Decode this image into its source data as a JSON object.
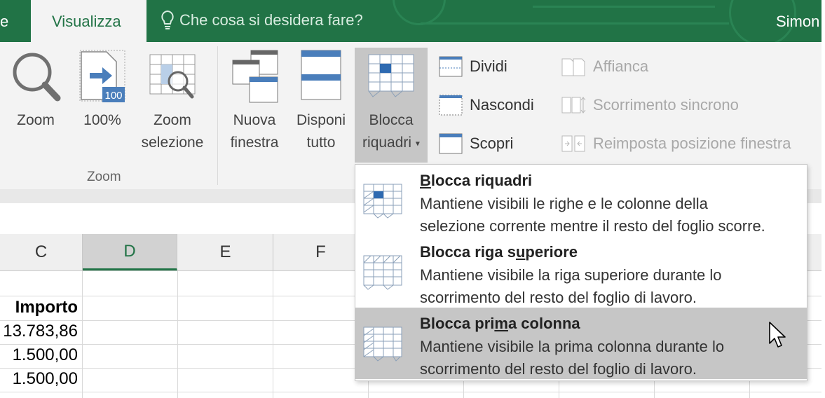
{
  "tabs": {
    "left_partial": "e",
    "active": "Visualizza",
    "tell_me": "Che cosa si desidera fare?",
    "user": "Simon"
  },
  "ribbon": {
    "zoom": "Zoom",
    "hundred": "100%",
    "hundred_badge": "100",
    "zoom_sel_1": "Zoom",
    "zoom_sel_2": "selezione",
    "group_zoom": "Zoom",
    "new_win_1": "Nuova",
    "new_win_2": "finestra",
    "arrange_1": "Disponi",
    "arrange_2": "tutto",
    "freeze_1": "Blocca",
    "freeze_2": "riquadri",
    "split": "Dividi",
    "hide": "Nascondi",
    "unhide": "Scopri",
    "side_by_side": "Affianca",
    "sync_scroll": "Scorrimento sincrono",
    "reset_pos": "Reimposta posizione finestra"
  },
  "grid": {
    "columns": [
      "C",
      "D",
      "E",
      "F"
    ],
    "header_cell": "Importo",
    "values": [
      "13.783,86",
      "1.500,00",
      "1.500,00"
    ]
  },
  "dropdown": {
    "items": [
      {
        "title_pre": "",
        "title_u": "B",
        "title_post": "locca riquadri",
        "desc1": "Mantiene visibili le righe e le colonne della",
        "desc2": "selezione corrente mentre il resto del foglio scorre."
      },
      {
        "title_pre": "Blocca riga s",
        "title_u": "u",
        "title_post": "periore",
        "desc1": "Mantiene visibile la riga superiore durante lo",
        "desc2": "scorrimento del resto del foglio di lavoro."
      },
      {
        "title_pre": "Blocca pri",
        "title_u": "m",
        "title_post": "a colonna",
        "desc1": "Mantiene visibile la prima colonna durante lo",
        "desc2": "scorrimento del resto del foglio di lavoro."
      }
    ]
  },
  "colors": {
    "excel_green": "#217346",
    "ribbon_bg": "#f3f3f3",
    "accent_blue": "#4a7ebb",
    "hover_gray": "#c6c6c6"
  }
}
